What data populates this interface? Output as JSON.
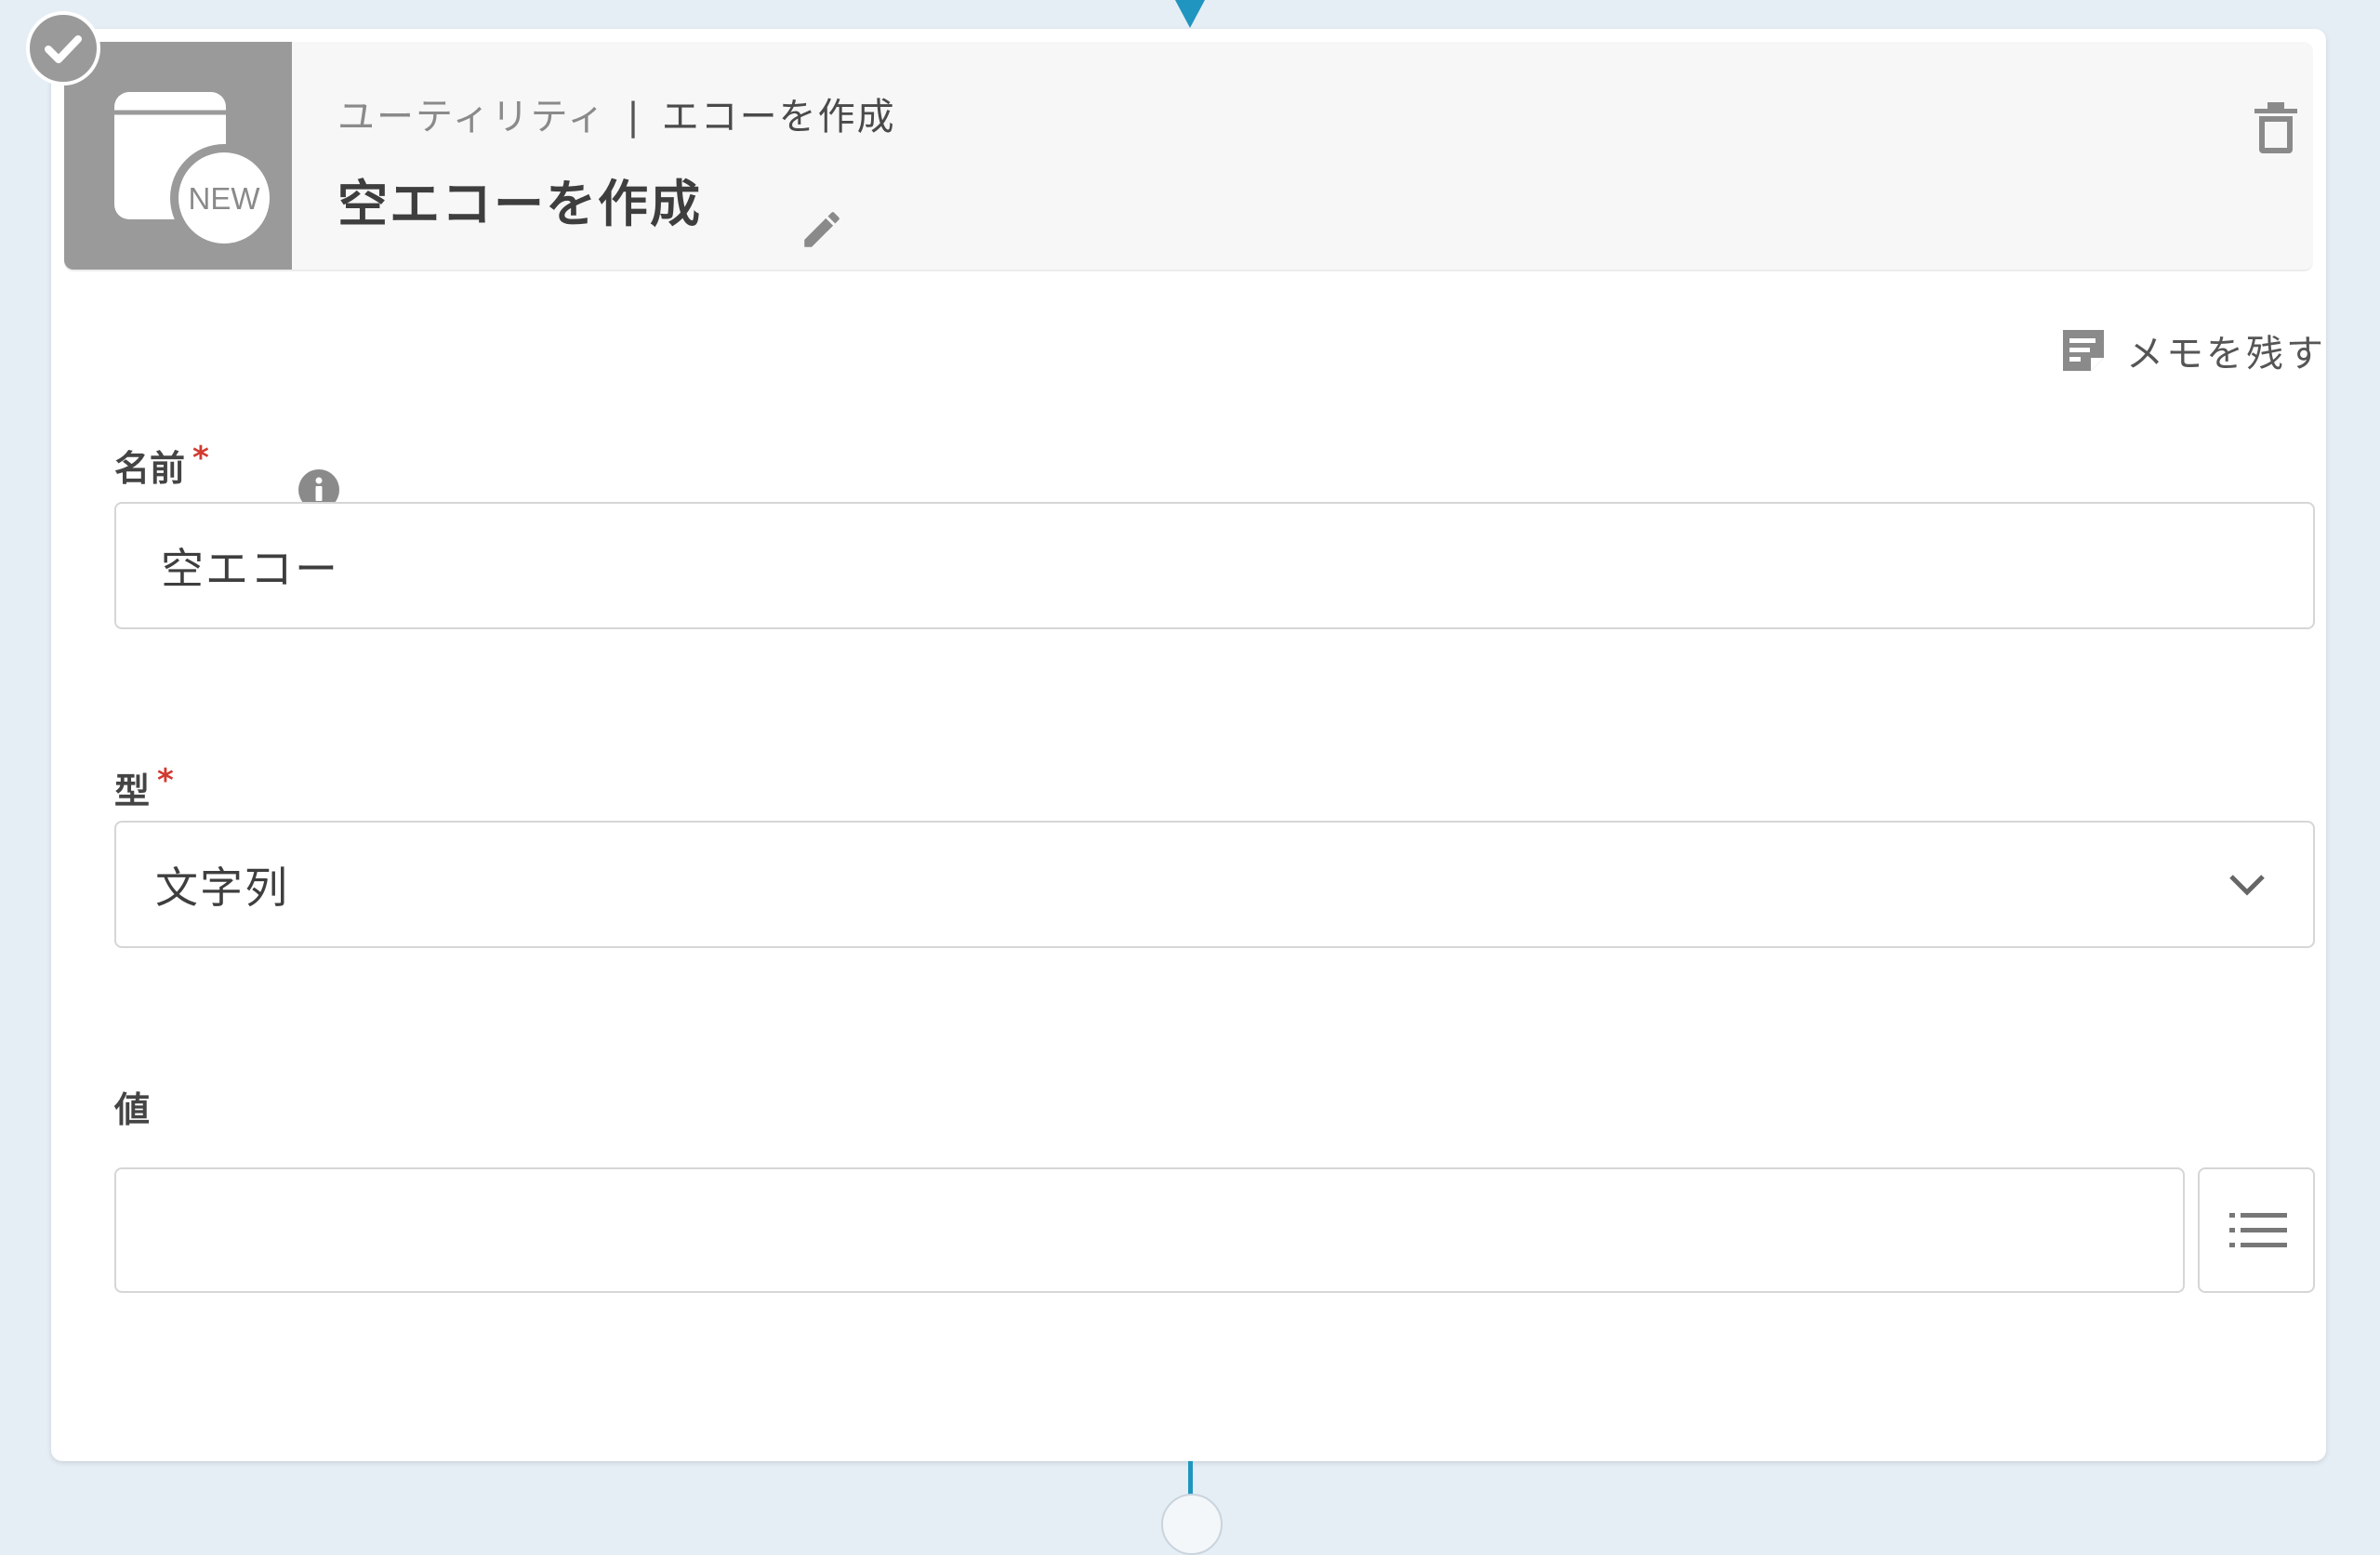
{
  "header": {
    "breadcrumb_category": "ユーティリティ",
    "breadcrumb_separator": "|",
    "breadcrumb_action": "エコーを作成",
    "title": "空エコーを作成",
    "icon_badge_text": "NEW"
  },
  "memo": {
    "label": "メモを残す"
  },
  "fields": {
    "name": {
      "label": "名前",
      "required_mark": "*",
      "value": "空エコー"
    },
    "type": {
      "label": "型",
      "required_mark": "*",
      "selected": "文字列"
    },
    "value": {
      "label": "値",
      "value": ""
    }
  },
  "icons": {
    "header_icon": "new-window-icon",
    "edit": "pencil-icon",
    "trash": "trash-icon",
    "check": "check-icon",
    "memo": "memo-icon",
    "info": "info-icon",
    "chevron": "chevron-down-icon",
    "list": "list-icon"
  },
  "colors": {
    "background": "#e6eef5",
    "accent": "#1f95bf",
    "required": "#d23a2f",
    "icon_gray": "#9a9a9a"
  }
}
